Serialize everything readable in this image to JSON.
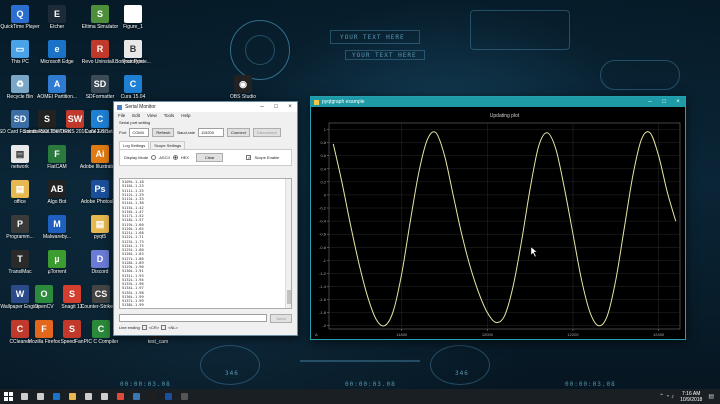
{
  "desktop": {
    "hud_text_1": "YOUR TEXT HERE",
    "hud_text_2": "YOUR TEXT HERE",
    "hud_time_1": "00:00:03.08",
    "hud_time_2": "00:00:03.08",
    "hud_time_3": "00:00:03.08",
    "hud_num_1": "346",
    "hud_num_2": "346",
    "icons": [
      {
        "label": "QuickTime Player",
        "color": "#2a6fd0",
        "icon": "quicktime-icon",
        "glyph": "Q"
      },
      {
        "label": "Etcher",
        "color": "#1d2a37",
        "icon": "etcher-icon",
        "glyph": "E"
      },
      {
        "label": "Eltima Simulator",
        "color": "#4d8f3a",
        "icon": "simulator-icon",
        "glyph": "S"
      },
      {
        "label": "Figure_1",
        "color": "#ffffff",
        "icon": "file-icon",
        "glyph": ""
      },
      {
        "label": "This PC",
        "color": "#4aa3e8",
        "icon": "computer-icon",
        "glyph": "▭"
      },
      {
        "label": "Microsoft Edge",
        "color": "#1a73c9",
        "icon": "edge-icon",
        "glyph": "e"
      },
      {
        "label": "Revo Uninstall...",
        "color": "#c0392b",
        "icon": "revo-icon",
        "glyph": "R"
      },
      {
        "label": "Prototype",
        "color": "#ffffff",
        "icon": "printer-icon",
        "glyph": "⎙"
      },
      {
        "label": "Bonjour Printe...",
        "color": "#e8e8e8",
        "icon": "bonjour-icon",
        "glyph": "B"
      },
      {
        "label": "Recycle Bin",
        "color": "#7aa6c7",
        "icon": "recycle-bin-icon",
        "glyph": "♻"
      },
      {
        "label": "AOMEI Partition...",
        "color": "#2f7bd1",
        "icon": "aomei-icon",
        "glyph": "A"
      },
      {
        "label": "SDFormatter",
        "color": "#3c4a56",
        "icon": "sd-icon",
        "glyph": "SD"
      },
      {
        "label": "Cura 15.04",
        "color": "#1f7fd3",
        "icon": "cura-icon",
        "glyph": "C"
      },
      {
        "label": "OBS Studio",
        "color": "#222",
        "icon": "obs-icon",
        "glyph": "◉"
      },
      {
        "label": "SD Card Formatter",
        "color": "#3a6ea5",
        "icon": "sd-card-icon",
        "glyph": "SD"
      },
      {
        "label": "Saints Row The Third",
        "color": "#222",
        "icon": "game-icon",
        "glyph": "S"
      },
      {
        "label": "SOLIDWORKS 2016 x64 Edi...",
        "color": "#c0392b",
        "icon": "solidworks-icon",
        "glyph": "SW"
      },
      {
        "label": "Cura 2.6 Beta",
        "color": "#1f7fd3",
        "icon": "cura-icon",
        "glyph": "C"
      },
      {
        "label": "Candle - Shortcut",
        "color": "#c0392b",
        "icon": "candle-icon",
        "glyph": "C"
      },
      {
        "label": "network",
        "color": "#e8e8e8",
        "icon": "folder-icon",
        "glyph": "▤"
      },
      {
        "label": "FlatCAM",
        "color": "#2b7a3d",
        "icon": "flatcam-icon",
        "glyph": "F"
      },
      {
        "label": "Adobe Illustrator...",
        "color": "#e07a13",
        "icon": "illustrator-icon",
        "glyph": "Ai"
      },
      {
        "label": "matlab - Shortcut",
        "color": "#e06c1a",
        "icon": "matlab-icon",
        "glyph": "M"
      },
      {
        "label": "office",
        "color": "#e6b84f",
        "icon": "folder-icon",
        "glyph": "▤"
      },
      {
        "label": "Algo Bot",
        "color": "#222",
        "icon": "algobot-icon",
        "glyph": "AB"
      },
      {
        "label": "Adobe Photosh...",
        "color": "#1b4f9c",
        "icon": "photoshop-icon",
        "glyph": "Ps"
      },
      {
        "label": "MPLAB IDE v8.04",
        "color": "#c0392b",
        "icon": "mplab-icon",
        "glyph": "M"
      },
      {
        "label": "Programm...",
        "color": "#3a3a3a",
        "icon": "program-icon",
        "glyph": "P"
      },
      {
        "label": "Malwareby...",
        "color": "#1f5fbf",
        "icon": "malwarebytes-icon",
        "glyph": "M"
      },
      {
        "label": "pyqt5",
        "color": "#e6b84f",
        "icon": "folder-icon",
        "glyph": "▤"
      },
      {
        "label": "KiCad",
        "color": "#b5451b",
        "icon": "kicad-icon",
        "glyph": "K"
      },
      {
        "label": "TranslMac",
        "color": "#2a2a2a",
        "icon": "translmac-icon",
        "glyph": "T"
      },
      {
        "label": "µTorrent",
        "color": "#3d9c2f",
        "icon": "utorrent-icon",
        "glyph": "µ"
      },
      {
        "label": "Discord",
        "color": "#6b7bd6",
        "icon": "discord-icon",
        "glyph": "D"
      },
      {
        "label": "Games",
        "color": "#e6b84f",
        "icon": "folder-icon",
        "glyph": "▤"
      },
      {
        "label": "Wallpaper Engine",
        "color": "#2a4a8a",
        "icon": "wallpaper-icon",
        "glyph": "W"
      },
      {
        "label": "OpenCV",
        "color": "#2c8a3d",
        "icon": "opencv-icon",
        "glyph": "O"
      },
      {
        "label": "Snagit 13",
        "color": "#d23f2f",
        "icon": "snagit-icon",
        "glyph": "S"
      },
      {
        "label": "Counter-Strike 1.6",
        "color": "#444",
        "icon": "cs-icon",
        "glyph": "CS"
      },
      {
        "label": "CCleaner",
        "color": "#c0392b",
        "icon": "ccleaner-icon",
        "glyph": "C"
      },
      {
        "label": "Mozilla Firefox",
        "color": "#e2661b",
        "icon": "firefox-icon",
        "glyph": "F"
      },
      {
        "label": "SpeedFan",
        "color": "#c0392b",
        "icon": "speedfan-icon",
        "glyph": "S"
      },
      {
        "label": "PIC C Compiler",
        "color": "#2b8a3a",
        "icon": "picc-icon",
        "glyph": "C"
      },
      {
        "label": "test_cam",
        "color": "#1f1f1f",
        "icon": "pycharm-icon",
        "glyph": "PC"
      }
    ]
  },
  "serial_monitor": {
    "title": "Serial Monitor",
    "menu": [
      "File",
      "Edit",
      "View",
      "Tools",
      "Help"
    ],
    "section_label": "Serial port setting",
    "port_label": "Port",
    "port_value": "COM4",
    "refresh_label": "Refresh",
    "baud_label": "Baud-rate",
    "baud_value": "115200",
    "connect_label": "Connect",
    "disconnect_label": "Disconnect",
    "tabs": [
      "Log Settings",
      "Scope Settings"
    ],
    "display_mode_label": "Display Mode",
    "ascii_label": "ASCII",
    "hex_label": "HEX",
    "clear_label": "Clear",
    "scope_enable_label": "Scope Enable",
    "log_lines": [
      "5109L-1.18",
      "5110L-1.23",
      "5111L-1.25",
      "5112L-1.29",
      "5113L-1.33",
      "5114L-1.38",
      "5115L-1.42",
      "5116L-1.47",
      "5117L-1.52",
      "5118L-1.57",
      "5119L-1.60",
      "5120L-1.65",
      "5121L-1.68",
      "5122L-1.71",
      "5123L-1.73",
      "5124L-1.75",
      "5125L-1.80",
      "5126L-1.83",
      "5127L-1.86",
      "5128L-1.89",
      "5129L-1.90",
      "5130L-1.91",
      "5131L-1.93",
      "5132L-1.94",
      "5133L-1.96",
      "5134L-1.97",
      "5135L-1.98",
      "5136L-1.99",
      "5137L-1.99",
      "5138L-1.99"
    ],
    "send_label": "Send",
    "line_ending_label": "Line ending",
    "cr_label": "<CR>",
    "nl_label": "<NL>"
  },
  "plot_window": {
    "title": "pyqtgraph example",
    "plot_title": "Updating plot",
    "y_ticks": [
      "1",
      "0.8",
      "0.6",
      "0.4",
      "0.2",
      "0",
      "-0.2",
      "-0.4",
      "-0.6",
      "-0.8",
      "-1",
      "-1.2",
      "-1.4",
      "-1.6",
      "-1.8",
      "-2"
    ],
    "x_ticks": [
      "11800",
      "12000",
      "12200",
      "12400"
    ],
    "corner_label": "A"
  },
  "taskbar": {
    "time": "7:16 AM",
    "date": "10/9/2018",
    "apps": [
      "search-icon",
      "task-view-icon",
      "edge-icon",
      "explorer-icon",
      "store-icon",
      "mail-icon",
      "chrome-icon",
      "python-icon",
      "pycharm-icon",
      "photoshop-icon",
      "obs-icon"
    ]
  },
  "chart_data": {
    "type": "line",
    "title": "Updating plot",
    "xlabel": "",
    "ylabel": "",
    "xlim": [
      11630,
      12450
    ],
    "ylim": [
      -2.05,
      1.1
    ],
    "grid": true,
    "x_ticks": [
      11800,
      12000,
      12200,
      12400
    ],
    "y_ticks": [
      1,
      0.8,
      0.6,
      0.4,
      0.2,
      0,
      -0.2,
      -0.4,
      -0.6,
      -0.8,
      -1,
      -1.2,
      -1.4,
      -1.6,
      -1.8,
      -2
    ],
    "series": [
      {
        "name": "",
        "color": "#e8e6a4",
        "x": [
          11640,
          11660,
          11680,
          11700,
          11720,
          11740,
          11760,
          11780,
          11800,
          11820,
          11840,
          11860,
          11880,
          11900,
          11920,
          11940,
          11960,
          11980,
          12000,
          12020,
          12040,
          12060,
          12080,
          12100,
          12120,
          12140,
          12160,
          12180,
          12200,
          12220,
          12240,
          12260,
          12280,
          12300,
          12320,
          12340,
          12360,
          12380,
          12400,
          12420,
          12440
        ],
        "y": [
          0.78,
          0.2,
          -0.45,
          -1.05,
          -1.55,
          -1.9,
          -2.0,
          -1.78,
          -1.2,
          -0.4,
          0.35,
          0.85,
          0.95,
          0.6,
          0.0,
          -0.6,
          -1.1,
          -1.5,
          -1.8,
          -1.95,
          -1.85,
          -1.4,
          -0.7,
          0.1,
          0.75,
          0.95,
          0.7,
          0.1,
          -0.6,
          -1.3,
          -1.8,
          -2.0,
          -1.85,
          -1.3,
          -0.5,
          0.3,
          0.85,
          0.95,
          0.6,
          0.05,
          -0.4
        ]
      }
    ]
  }
}
